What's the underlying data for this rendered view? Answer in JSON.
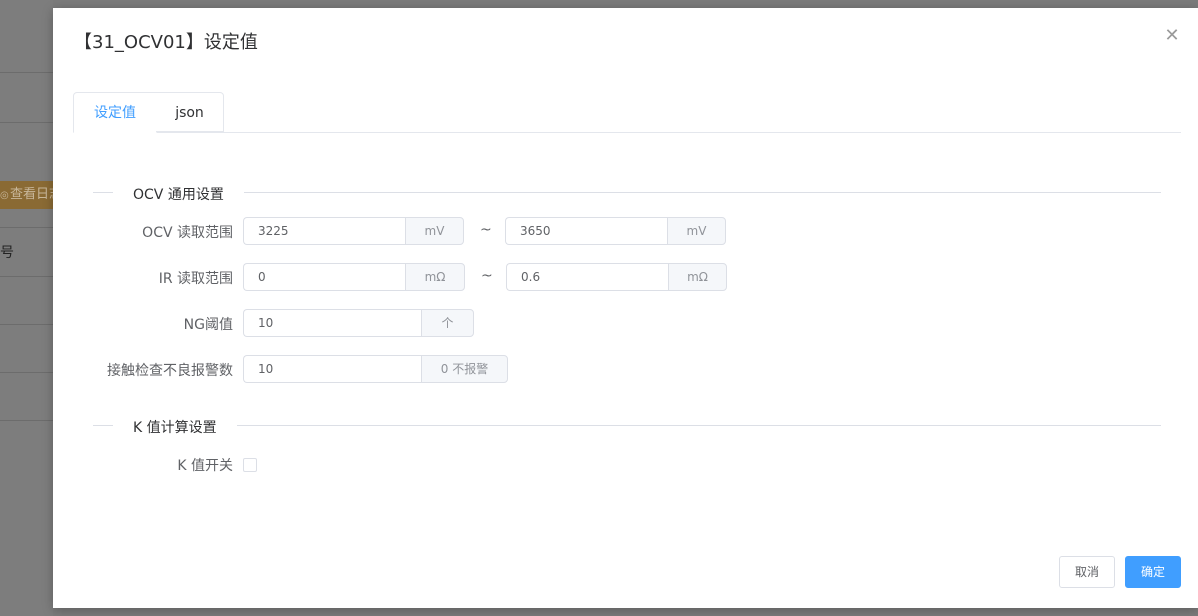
{
  "background": {
    "button_label": "查看日志",
    "side_text": "号"
  },
  "dialog": {
    "title": "【31_OCV01】设定值",
    "tabs": [
      {
        "label": "设定值",
        "active": true
      },
      {
        "label": "json",
        "active": false
      }
    ],
    "sections": {
      "ocv_general": "OCV 通用设置",
      "k_value": "K 值计算设置"
    },
    "fields": {
      "ocv_range": {
        "label": "OCV 读取范围",
        "min": "3225",
        "max": "3650",
        "unit": "mV",
        "separator": "~"
      },
      "ir_range": {
        "label": "IR 读取范围",
        "min": "0",
        "max": "0.6",
        "unit": "mΩ",
        "separator": "~"
      },
      "ng_threshold": {
        "label": "NG阈值",
        "value": "10",
        "unit": "个"
      },
      "contact_check": {
        "label": "接触检查不良报警数",
        "value": "10",
        "unit": "0 不报警"
      },
      "k_switch": {
        "label": "K 值开关",
        "checked": false
      }
    },
    "buttons": {
      "cancel": "取消",
      "confirm": "确定"
    }
  },
  "colors": {
    "accent": "#409eff",
    "overlay": "#7b7b7b",
    "warning_button": "#8a6a34"
  }
}
